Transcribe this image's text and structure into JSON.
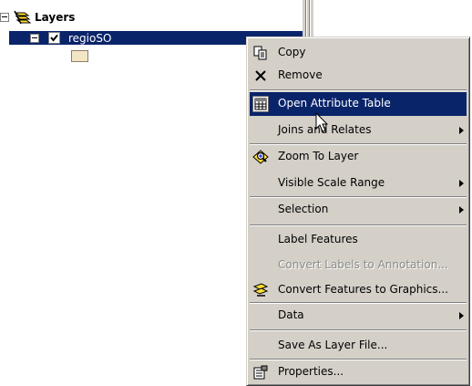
{
  "toc": {
    "root_label": "Layers",
    "layer_name": "regioSO"
  },
  "context_menu": {
    "items": [
      {
        "label": "Copy",
        "icon": "copy-icon"
      },
      {
        "label": "Remove",
        "icon": "remove-icon"
      },
      {
        "label": "Open Attribute Table",
        "icon": "attribute-table-icon",
        "highlighted": true
      },
      {
        "label": "Joins and Relates",
        "submenu": true
      },
      {
        "label": "Zoom To Layer",
        "icon": "zoom-to-layer-icon"
      },
      {
        "label": "Visible Scale Range",
        "submenu": true
      },
      {
        "label": "Selection",
        "submenu": true
      },
      {
        "label": "Label Features"
      },
      {
        "label": "Convert Labels to Annotation...",
        "disabled": true
      },
      {
        "label": "Convert Features to Graphics...",
        "icon": "convert-graphics-icon"
      },
      {
        "label": "Data",
        "submenu": true
      },
      {
        "label": "Save As Layer File..."
      },
      {
        "label": "Properties...",
        "icon": "properties-icon"
      }
    ]
  },
  "colors": {
    "selection": "#0a246a",
    "menu_face": "#d4d0c8",
    "symbol_fill": "#f2e6c4"
  }
}
